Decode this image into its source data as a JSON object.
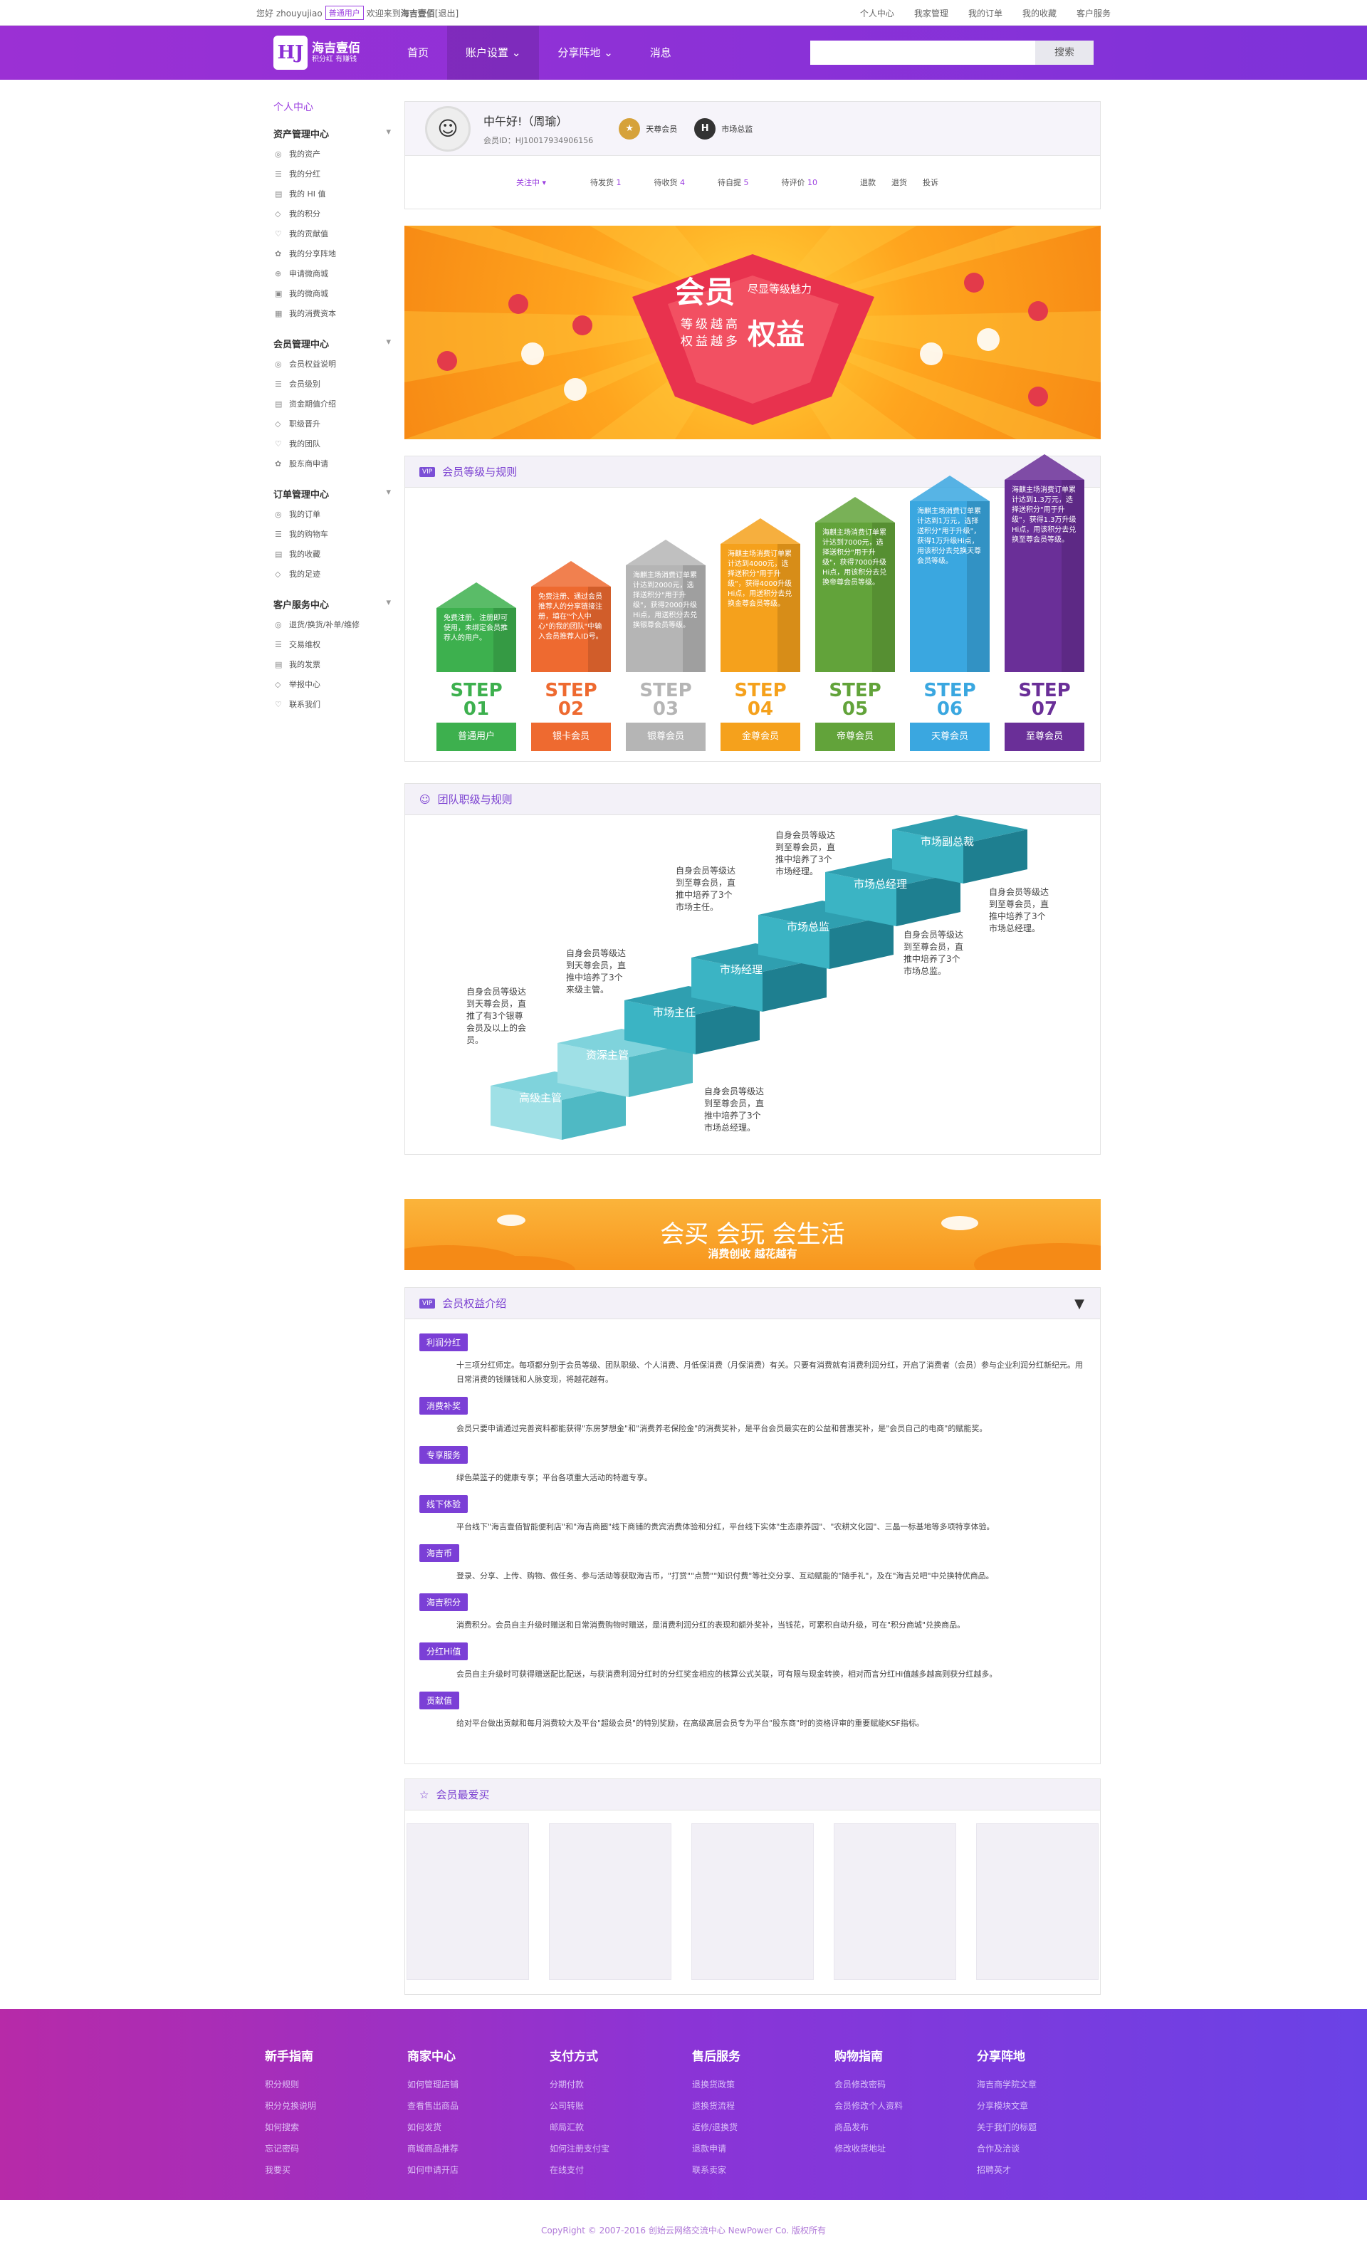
{
  "topbar": {
    "hello": "您好 zhouyujiao",
    "role": "普通用户",
    "welcome": "欢迎来到",
    "site": "海吉壹佰",
    "logout": "[退出]",
    "links": [
      "个人中心",
      "我家管理",
      "我的订单",
      "我的收藏",
      "客户服务"
    ]
  },
  "nav": {
    "logo_title": "海吉壹佰",
    "logo_sub": "积分红 有赚钱",
    "items": [
      "首页",
      "账户设置",
      "分享阵地",
      "消息"
    ],
    "search_btn": "搜索",
    "search_value": ""
  },
  "sidebar": {
    "title": "个人中心",
    "groups": [
      {
        "name": "资产管理中心",
        "items": [
          "我的资产",
          "我的分红",
          "我的 HI 值",
          "我的积分",
          "我的贡献值",
          "我的分享阵地",
          "申请微商城",
          "我的微商城",
          "我的消费资本"
        ]
      },
      {
        "name": "会员管理中心",
        "items": [
          "会员权益说明",
          "会员级别",
          "资金期值介绍",
          "职级晋升",
          "我的团队",
          "股东商申请"
        ]
      },
      {
        "name": "订单管理中心",
        "items": [
          "我的订单",
          "我的购物车",
          "我的收藏",
          "我的足迹"
        ]
      },
      {
        "name": "客户服务中心",
        "items": [
          "退货/换货/补单/维修",
          "交易维权",
          "我的发票",
          "举报中心",
          "联系我们"
        ]
      }
    ]
  },
  "user": {
    "greeting": "中午好!（周瑜）",
    "member_id": "会员ID：HJ10017934906156",
    "medals": [
      "天尊会员",
      "市场总监"
    ],
    "tabs": [
      {
        "label": "关注中",
        "count": ""
      },
      {
        "label": "待发货",
        "count": "1"
      },
      {
        "label": "待收货",
        "count": "4"
      },
      {
        "label": "待自提",
        "count": "5"
      },
      {
        "label": "待评价",
        "count": "10"
      }
    ],
    "links": [
      "退款",
      "退货",
      "投诉"
    ]
  },
  "banner": {
    "big": "会员",
    "sub1": "尽显等级魅力",
    "sub2": "等级越高",
    "sub3": "权益越多",
    "big2": "权益"
  },
  "steps": {
    "title": "会员等级与规则",
    "items": [
      {
        "step": "STEP",
        "num": "01",
        "name": "普通用户",
        "color": "#3db04e",
        "desc": "免费注册、注册即可使用，未绑定会员推荐人的用户。"
      },
      {
        "step": "STEP",
        "num": "02",
        "name": "银卡会员",
        "color": "#ee6a30",
        "desc": "免费注册、通过会员推荐人的分享链接注册，填在\"个人中心\"的我的团队\"中输入会员推荐人ID号。"
      },
      {
        "step": "STEP",
        "num": "03",
        "name": "银尊会员",
        "color": "#b5b5b5",
        "desc": "海麒主场消费订单累计达到2000元，选择送积分\"用于升级\"，获得2000升级Hi点，用送积分去兑换银尊会员等级。"
      },
      {
        "step": "STEP",
        "num": "04",
        "name": "金尊会员",
        "color": "#f5a11c",
        "desc": "海麒主场消费订单累计达到4000元，选择送积分\"用于升级\"，获得4000升级Hi点，用送积分去兑换金尊会员等级。"
      },
      {
        "step": "STEP",
        "num": "05",
        "name": "帝尊会员",
        "color": "#62a33a",
        "desc": "海麒主场消费订单累计达到7000元，选择送积分\"用于升级\"，获得7000升级Hi点，用该积分去兑换帝尊会员等级。"
      },
      {
        "step": "STEP",
        "num": "06",
        "name": "天尊会员",
        "color": "#3aa7e0",
        "desc": "海麒主场消费订单累计达到1万元，选择送积分\"用于升级\"，获得1万升级Hi点，用该积分去兑换天尊会员等级。"
      },
      {
        "step": "STEP",
        "num": "07",
        "name": "至尊会员",
        "color": "#6a2f98",
        "desc": "海麒主场消费订单累计达到1.3万元，选择送积分\"用于升级\"，获得1.3万升级Hi点，用该积分去兑换至尊会员等级。"
      }
    ]
  },
  "team": {
    "title": "团队职级与规则",
    "levels": [
      "高级主管",
      "资深主管",
      "市场主任",
      "市场经理",
      "市场总监",
      "市场总经理",
      "市场副总裁"
    ],
    "notes": [
      "自身会员等级达到天尊会员，直推了有3个银尊会员及以上的会员。",
      "自身会员等级达到天尊会员，直推中培养了3个来级主管。",
      "自身会员等级达到至尊会员，直推中培养了3个市场主任。",
      "自身会员等级达到至尊会员，直推中培养了3个市场经理。",
      "自身会员等级达到至尊会员，直推中培养了3个市场总监。",
      "自身会员等级达到至尊会员，直推中培养了3个市场总经理。",
      "自身会员等级达到至尊会员，直推中培养了3个市场总经理。"
    ]
  },
  "banner2": {
    "text": "会买  会玩  会生活",
    "sub": "消费创收  越花越有"
  },
  "rights": {
    "title": "会员权益介绍",
    "items": [
      {
        "tag": "利润分红",
        "text": "十三项分红师定。每项都分别于会员等级、团队职级、个人消费、月低保消费（月保消费）有关。只要有消费就有消费利润分红，开启了消费者（会员）参与企业利润分红新纪元。用日常消费的钱赚钱和人脉变现，将越花越有。"
      },
      {
        "tag": "消费补奖",
        "text": "会员只要申请通过完善资料都能获得\"东房梦想金\"和\"消费养老保险金\"的消费奖补，是平台会员最实在的公益和普惠奖补，是\"会员自己的电商\"的赋能奖。"
      },
      {
        "tag": "专享服务",
        "text": "绿色菜篮子的健康专享；平台各项重大活动的特邀专享。"
      },
      {
        "tag": "线下体验",
        "text": "平台线下\"海吉壹佰智能便利店\"和\"海吉商圈\"线下商铺的贵宾消费体验和分红，平台线下实体\"生态康养园\"、\"农耕文化园\"、三晶一标基地等多项特享体验。"
      },
      {
        "tag": "海吉币",
        "text": "登录、分享、上传、购物、做任务、参与活动等获取海吉币，\"打赏\"\"点赞\"\"知识付费\"等社交分享、互动赋能的\"随手礼\"，及在\"海吉兑吧\"中兑换特优商品。"
      },
      {
        "tag": "海吉积分",
        "text": "消费积分。会员自主升级时赠送和日常消费购物时赠送，是消费利润分红的表现和额外奖补，当钱花，可累积自动升级，可在\"积分商城\"兑换商品。"
      },
      {
        "tag": "分红Hi值",
        "text": "会员自主升级时可获得赠送配比配送，与获消费利润分红时的分红奖金相应的核算公式关联，可有限与现金转换，相对而言分红Hi值越多越高则获分红越多。"
      },
      {
        "tag": "贡献值",
        "text": "给对平台做出贡献和每月消费较大及平台\"超级会员\"的特别奖励，在高级高层会员专为平台\"股东商\"时的资格评审的重要赋能KSF指标。"
      }
    ]
  },
  "fav": {
    "title": "会员最爱买"
  },
  "footer": {
    "cols": [
      {
        "title": "新手指南",
        "items": [
          "积分规则",
          "积分兑换说明",
          "如何搜索",
          "忘记密码",
          "我要买"
        ]
      },
      {
        "title": "商家中心",
        "items": [
          "如何管理店铺",
          "查看售出商品",
          "如何发货",
          "商城商品推荐",
          "如何申请开店"
        ]
      },
      {
        "title": "支付方式",
        "items": [
          "分期付款",
          "公司转账",
          "邮局汇款",
          "如何注册支付宝",
          "在线支付"
        ]
      },
      {
        "title": "售后服务",
        "items": [
          "退换货政策",
          "退换货流程",
          "返修/退换货",
          "退款申请",
          "联系卖家"
        ]
      },
      {
        "title": "购物指南",
        "items": [
          "会员修改密码",
          "会员修改个人资料",
          "商品发布",
          "修改收货地址"
        ]
      },
      {
        "title": "分享阵地",
        "items": [
          "海吉商学院文章",
          "分享模块文章",
          "关于我们的标题",
          "合作及洽谈",
          "招聘英才"
        ]
      }
    ],
    "copyright": "CopyRight © 2007-2016 创始云网络交流中心 NewPower Co. 版权所有"
  }
}
